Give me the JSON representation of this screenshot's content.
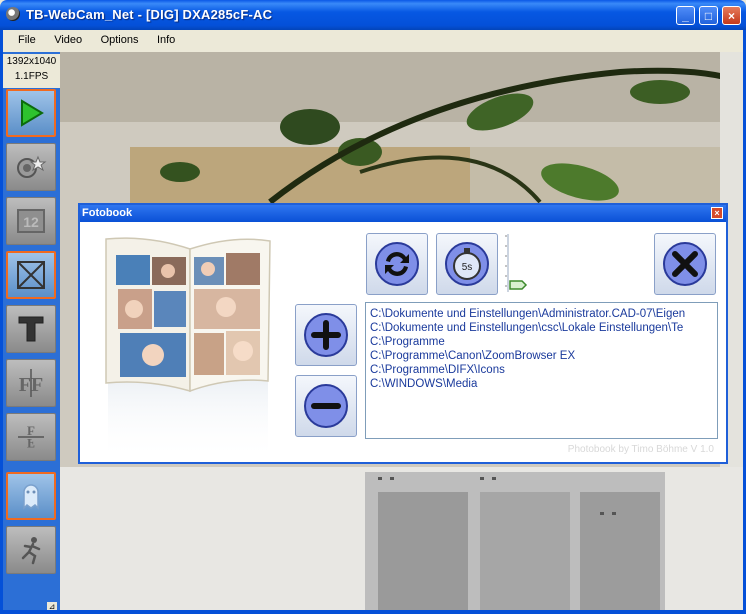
{
  "window": {
    "title": "TB-WebCam_Net - [DIG] DXA285cF-AC",
    "minimize_glyph": "_",
    "maximize_glyph": "□",
    "close_glyph": "×"
  },
  "menu": [
    "File",
    "Video",
    "Options",
    "Info"
  ],
  "status": {
    "resolution": "1392x1040",
    "fps": "1.1FPS"
  },
  "toolbar": {
    "tools": [
      {
        "icon": "play-icon",
        "active": true
      },
      {
        "icon": "camera-settings-icon",
        "active": false
      },
      {
        "icon": "counter-icon",
        "active": false
      },
      {
        "icon": "fit-frame-icon",
        "active": true
      },
      {
        "icon": "text-overlay-icon",
        "active": false
      },
      {
        "icon": "flip-horizontal-icon",
        "active": false
      },
      {
        "icon": "flip-vertical-icon",
        "active": false
      },
      {
        "icon": "ghost-icon",
        "active": true
      },
      {
        "icon": "running-man-icon",
        "active": false
      }
    ]
  },
  "dialog": {
    "title": "Fotobook",
    "close_glyph": "×",
    "timer_label": "5s",
    "paths": [
      "C:\\Dokumente und Einstellungen\\Administrator.CAD-07\\Eigen",
      "C:\\Dokumente und Einstellungen\\csc\\Lokale Einstellungen\\Te",
      "C:\\Programme",
      "C:\\Programme\\Canon\\ZoomBrowser EX",
      "C:\\Programme\\DIFX\\Icons",
      "C:\\WINDOWS\\Media"
    ],
    "credit": "Photobook by Timo Böhme V 1.0"
  },
  "colors": {
    "xp_blue": "#0450d8",
    "accent_orange": "#f06a20",
    "path_text": "#1a3a9c"
  }
}
